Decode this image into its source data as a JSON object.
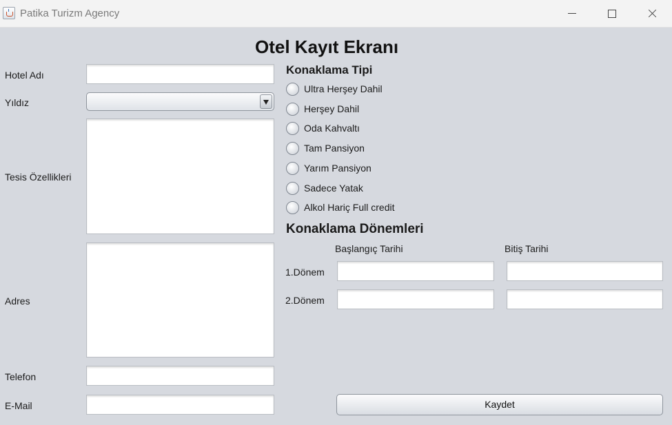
{
  "window": {
    "title": "Patika Turizm Agency"
  },
  "header": {
    "title": "Otel Kayıt Ekranı"
  },
  "form": {
    "hotel_name_label": "Hotel Adı",
    "hotel_name_value": "",
    "star_label": "Yıldız",
    "star_value": "",
    "facilities_label": "Tesis Özellikleri",
    "facilities_value": "",
    "address_label": "Adres",
    "address_value": "",
    "phone_label": "Telefon",
    "phone_value": "",
    "email_label": "E-Mail",
    "email_value": ""
  },
  "accommodation": {
    "title": "Konaklama Tipi",
    "options": [
      "Ultra Herşey Dahil",
      "Herşey Dahil",
      "Oda Kahvaltı",
      "Tam Pansiyon",
      "Yarım Pansiyon",
      "Sadece Yatak",
      "Alkol Hariç Full credit"
    ]
  },
  "periods": {
    "title": "Konaklama Dönemleri",
    "start_header": "Başlangıç Tarihi",
    "end_header": "Bitiş Tarihi",
    "rows": [
      {
        "label": "1.Dönem",
        "start": "",
        "end": ""
      },
      {
        "label": "2.Dönem",
        "start": "",
        "end": ""
      }
    ]
  },
  "actions": {
    "save_label": "Kaydet"
  },
  "icons": {
    "app": "java-cup-icon",
    "minimize": "minimize-icon",
    "maximize": "maximize-icon",
    "close": "close-icon",
    "dropdown": "chevron-down-icon"
  },
  "colors": {
    "background": "#d6d9df",
    "titlebar": "#f3f3f3"
  }
}
